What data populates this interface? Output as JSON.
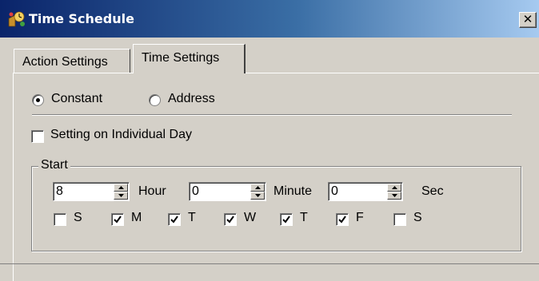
{
  "window": {
    "title": "Time Schedule",
    "icon": "schedule-app-icon",
    "close_glyph": "✕"
  },
  "tabs": [
    {
      "label": "Action Settings",
      "active": false
    },
    {
      "label": "Time Settings",
      "active": true
    }
  ],
  "mode": {
    "options": [
      {
        "label": "Constant",
        "selected": true
      },
      {
        "label": "Address",
        "selected": false
      }
    ]
  },
  "individual_day": {
    "label": "Setting on Individual Day",
    "checked": false
  },
  "start": {
    "group_label": "Start",
    "hour": {
      "value": "8",
      "unit": "Hour"
    },
    "minute": {
      "value": "0",
      "unit": "Minute"
    },
    "sec": {
      "value": "0",
      "unit": "Sec"
    },
    "days": [
      {
        "label": "S",
        "checked": false
      },
      {
        "label": "M",
        "checked": true
      },
      {
        "label": "T",
        "checked": true
      },
      {
        "label": "W",
        "checked": true
      },
      {
        "label": "T",
        "checked": true
      },
      {
        "label": "F",
        "checked": true
      },
      {
        "label": "S",
        "checked": false
      }
    ]
  },
  "colors": {
    "titlebar_start": "#0a246a",
    "titlebar_end": "#a6caf0",
    "face": "#d4d0c8"
  }
}
